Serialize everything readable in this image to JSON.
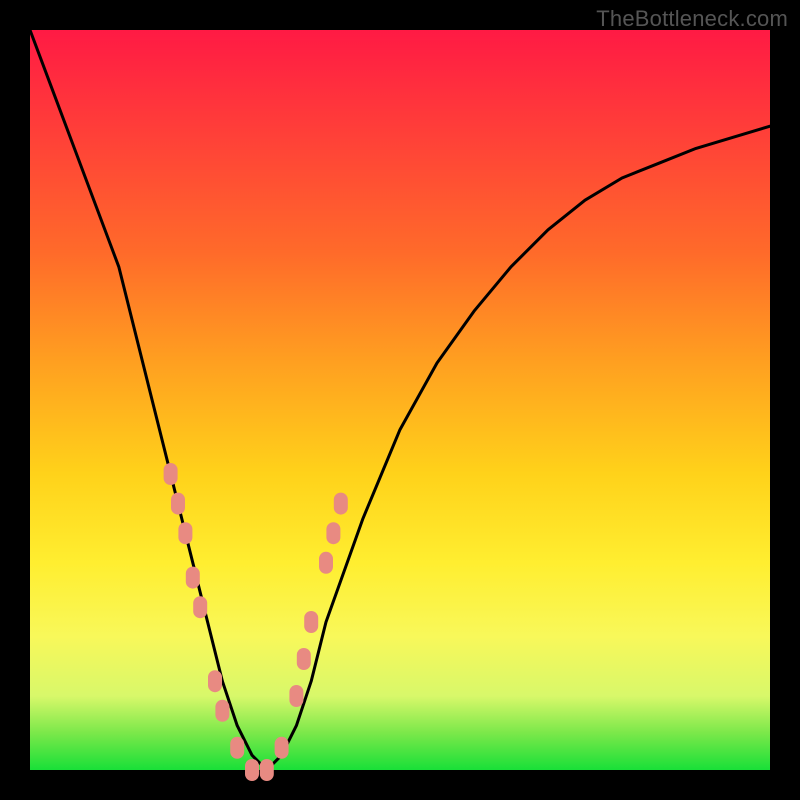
{
  "watermark": "TheBottleneck.com",
  "chart_data": {
    "type": "line",
    "title": "",
    "xlabel": "",
    "ylabel": "",
    "xlim": [
      0,
      100
    ],
    "ylim": [
      0,
      100
    ],
    "series": [
      {
        "name": "bottleneck-curve",
        "x": [
          0,
          3,
          6,
          9,
          12,
          14,
          16,
          18,
          20,
          22,
          24,
          26,
          28,
          30,
          32,
          34,
          36,
          38,
          40,
          45,
          50,
          55,
          60,
          65,
          70,
          75,
          80,
          85,
          90,
          95,
          100
        ],
        "values": [
          100,
          92,
          84,
          76,
          68,
          60,
          52,
          44,
          36,
          28,
          20,
          12,
          6,
          2,
          0,
          2,
          6,
          12,
          20,
          34,
          46,
          55,
          62,
          68,
          73,
          77,
          80,
          82,
          84,
          85.5,
          87
        ]
      }
    ],
    "annotations": {
      "markers": [
        {
          "x_approx": 19,
          "y_approx": 40,
          "note": "data point"
        },
        {
          "x_approx": 20,
          "y_approx": 36,
          "note": "data point"
        },
        {
          "x_approx": 21,
          "y_approx": 32,
          "note": "data point"
        },
        {
          "x_approx": 22,
          "y_approx": 26,
          "note": "data point"
        },
        {
          "x_approx": 23,
          "y_approx": 22,
          "note": "data point"
        },
        {
          "x_approx": 25,
          "y_approx": 12,
          "note": "data point"
        },
        {
          "x_approx": 26,
          "y_approx": 8,
          "note": "data point"
        },
        {
          "x_approx": 28,
          "y_approx": 3,
          "note": "data point"
        },
        {
          "x_approx": 30,
          "y_approx": 0,
          "note": "data point"
        },
        {
          "x_approx": 32,
          "y_approx": 0,
          "note": "data point"
        },
        {
          "x_approx": 34,
          "y_approx": 3,
          "note": "data point"
        },
        {
          "x_approx": 36,
          "y_approx": 10,
          "note": "data point"
        },
        {
          "x_approx": 37,
          "y_approx": 15,
          "note": "data point"
        },
        {
          "x_approx": 38,
          "y_approx": 20,
          "note": "data point"
        },
        {
          "x_approx": 40,
          "y_approx": 28,
          "note": "data point"
        },
        {
          "x_approx": 41,
          "y_approx": 32,
          "note": "data point"
        },
        {
          "x_approx": 42,
          "y_approx": 36,
          "note": "data point"
        }
      ],
      "marker_color": "#e88a82",
      "curve_color": "#000000"
    }
  }
}
